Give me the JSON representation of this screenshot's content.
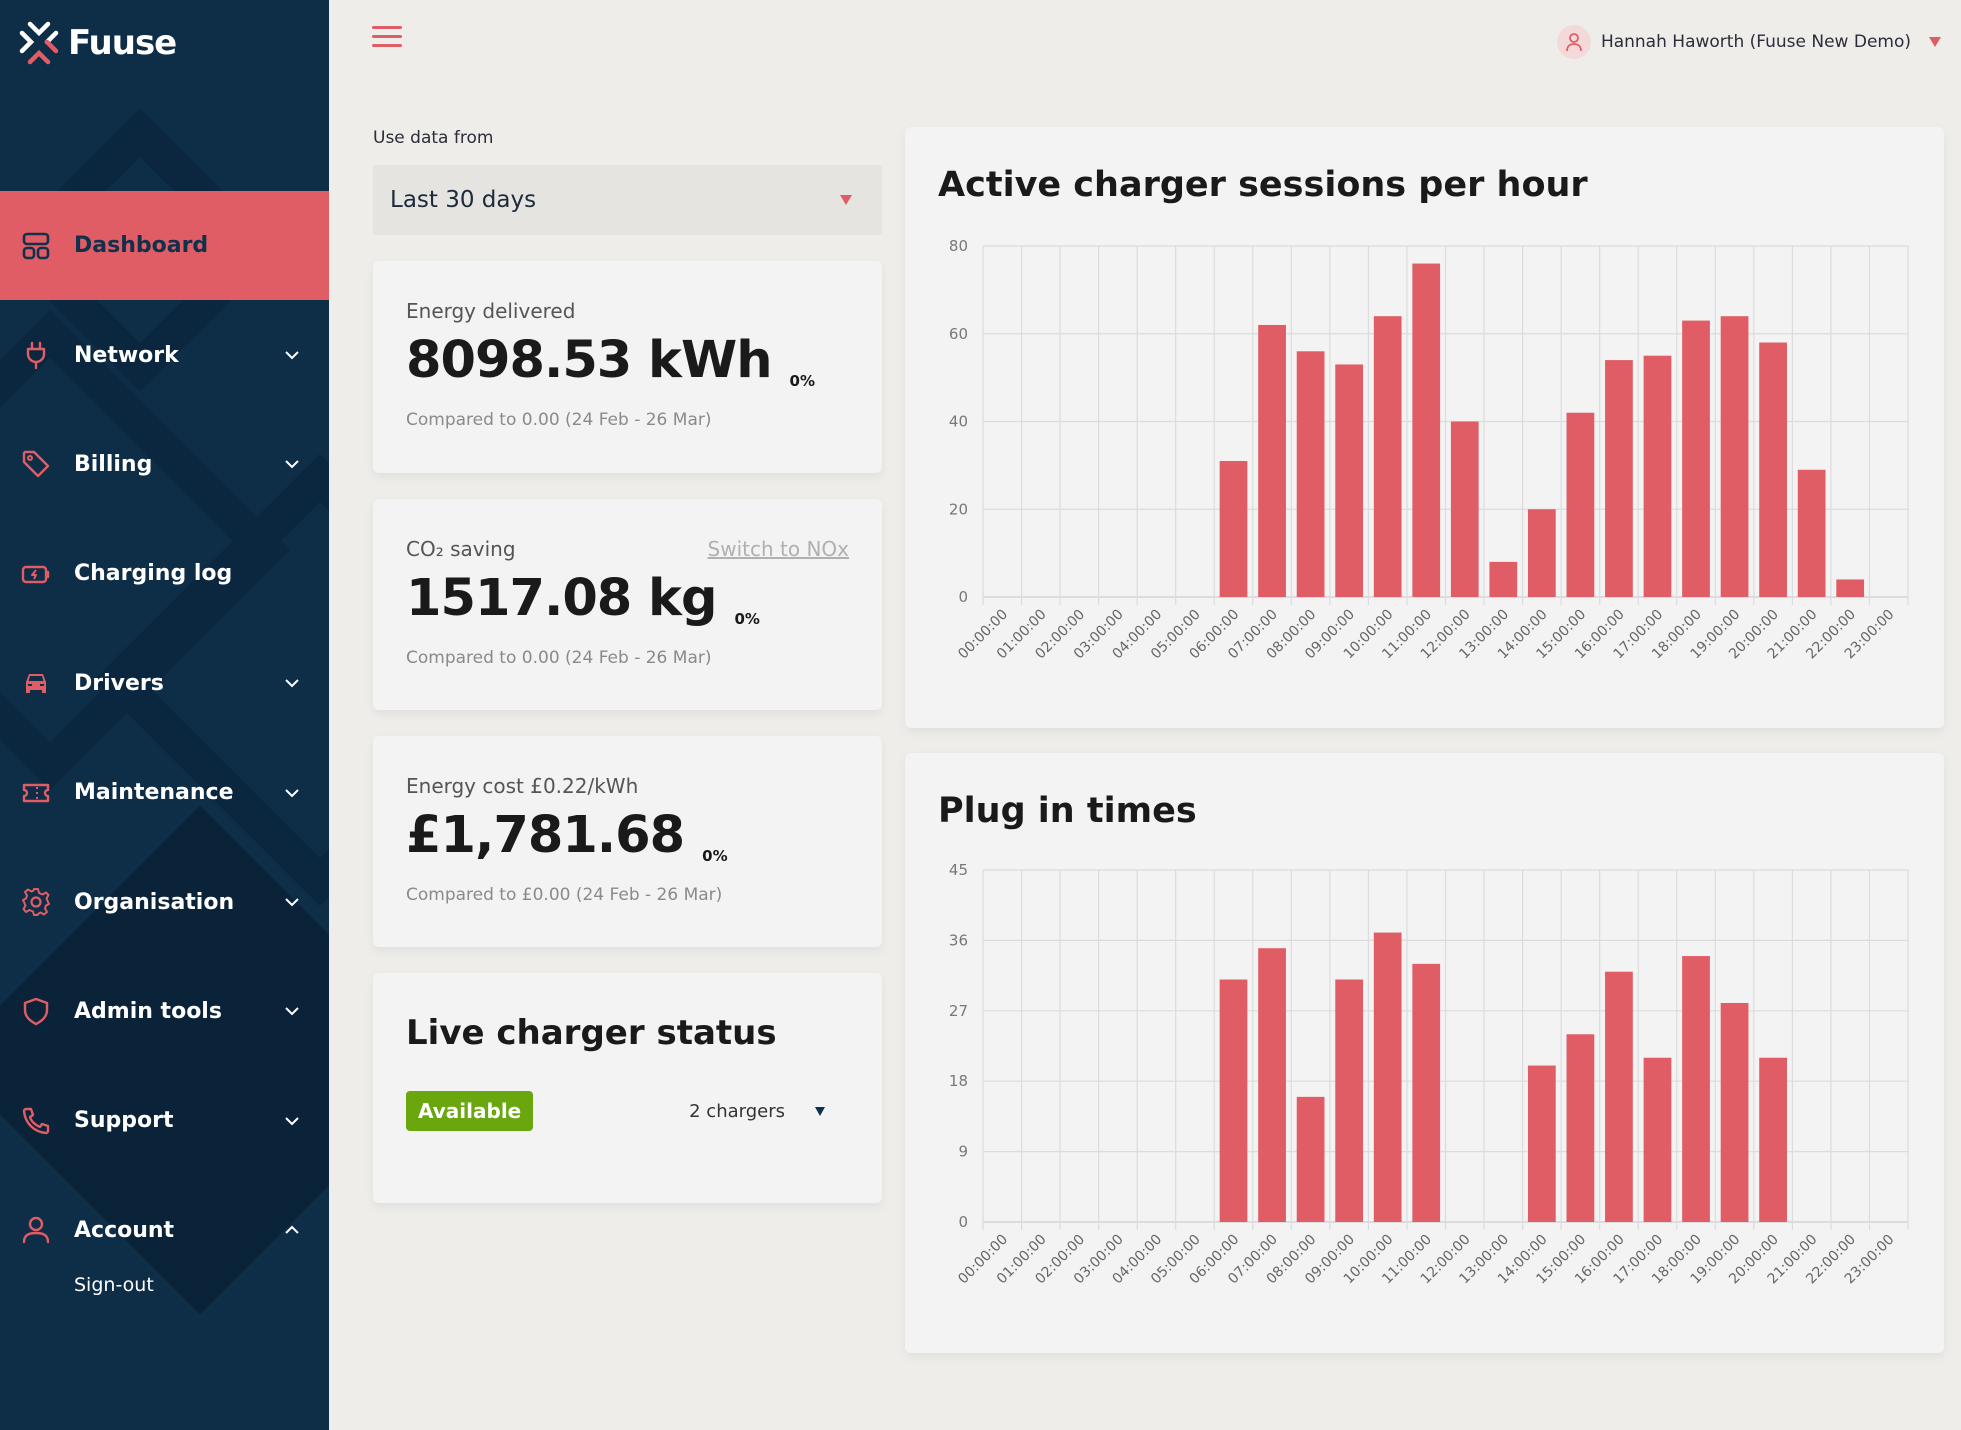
{
  "app": {
    "brand": "Fuuse",
    "accent_color": "#e05d66",
    "sidebar_color": "#0e2d47"
  },
  "sidebar": {
    "items": [
      {
        "label": "Dashboard",
        "icon": "dashboard-icon",
        "active": true,
        "expandable": false
      },
      {
        "label": "Network",
        "icon": "plug-icon",
        "expandable": true,
        "expanded": false
      },
      {
        "label": "Billing",
        "icon": "tag-icon",
        "expandable": true,
        "expanded": false
      },
      {
        "label": "Charging log",
        "icon": "battery-charging-icon",
        "expandable": false
      },
      {
        "label": "Drivers",
        "icon": "car-icon",
        "expandable": true,
        "expanded": false
      },
      {
        "label": "Maintenance",
        "icon": "ticket-icon",
        "expandable": true,
        "expanded": false
      },
      {
        "label": "Organisation",
        "icon": "gear-icon",
        "expandable": true,
        "expanded": false
      },
      {
        "label": "Admin tools",
        "icon": "shield-icon",
        "expandable": true,
        "expanded": false
      },
      {
        "label": "Support",
        "icon": "phone-icon",
        "expandable": true,
        "expanded": false
      },
      {
        "label": "Account",
        "icon": "user-icon",
        "expandable": true,
        "expanded": true,
        "children": [
          {
            "label": "Sign-out"
          }
        ]
      }
    ]
  },
  "header": {
    "menu_icon": "hamburger-icon",
    "user_name": "Hannah Haworth (Fuuse New Demo)"
  },
  "filters": {
    "label": "Use data from",
    "selected": "Last 30 days"
  },
  "stats": [
    {
      "title": "Energy delivered",
      "value": "8098.53 kWh",
      "change": "0%",
      "compare": "Compared to 0.00 (24 Feb - 26 Mar)"
    },
    {
      "title": "CO₂ saving",
      "link": "Switch to NOx",
      "value": "1517.08 kg",
      "change": "0%",
      "compare": "Compared to 0.00 (24 Feb - 26 Mar)"
    },
    {
      "title": "Energy cost £0.22/kWh",
      "value": "£1,781.68",
      "change": "0%",
      "compare": "Compared to £0.00 (24 Feb - 26 Mar)"
    }
  ],
  "live_status": {
    "title": "Live charger status",
    "badge": "Available",
    "badge_color": "#6aa70f",
    "chargers_selected": "2 chargers"
  },
  "chart_data": [
    {
      "type": "bar",
      "title": "Active charger sessions per hour",
      "xlabel": "",
      "ylabel": "",
      "categories": [
        "00:00:00",
        "01:00:00",
        "02:00:00",
        "03:00:00",
        "04:00:00",
        "05:00:00",
        "06:00:00",
        "07:00:00",
        "08:00:00",
        "09:00:00",
        "10:00:00",
        "11:00:00",
        "12:00:00",
        "13:00:00",
        "14:00:00",
        "15:00:00",
        "16:00:00",
        "17:00:00",
        "18:00:00",
        "19:00:00",
        "20:00:00",
        "21:00:00",
        "22:00:00",
        "23:00:00"
      ],
      "values": [
        0,
        0,
        0,
        0,
        0,
        0,
        31,
        62,
        56,
        53,
        64,
        76,
        40,
        8,
        20,
        42,
        54,
        55,
        63,
        64,
        58,
        29,
        4,
        0
      ],
      "ylim": [
        0,
        80
      ],
      "yticks": [
        0,
        20,
        40,
        60,
        80
      ],
      "grid": true,
      "legend": "none",
      "color": "#e05d66"
    },
    {
      "type": "bar",
      "title": "Plug in times",
      "xlabel": "",
      "ylabel": "",
      "categories": [
        "00:00:00",
        "01:00:00",
        "02:00:00",
        "03:00:00",
        "04:00:00",
        "05:00:00",
        "06:00:00",
        "07:00:00",
        "08:00:00",
        "09:00:00",
        "10:00:00",
        "11:00:00",
        "12:00:00",
        "13:00:00",
        "14:00:00",
        "15:00:00",
        "16:00:00",
        "17:00:00",
        "18:00:00",
        "19:00:00",
        "20:00:00",
        "21:00:00",
        "22:00:00",
        "23:00:00"
      ],
      "values": [
        0,
        0,
        0,
        0,
        0,
        0,
        31,
        35,
        16,
        31,
        37,
        33,
        0,
        0,
        20,
        24,
        32,
        21,
        34,
        28,
        21,
        0,
        0,
        0
      ],
      "ylim": [
        0,
        45
      ],
      "yticks": [
        0,
        9,
        18,
        27,
        36,
        45
      ],
      "grid": true,
      "legend": "none",
      "color": "#e05d66"
    }
  ]
}
